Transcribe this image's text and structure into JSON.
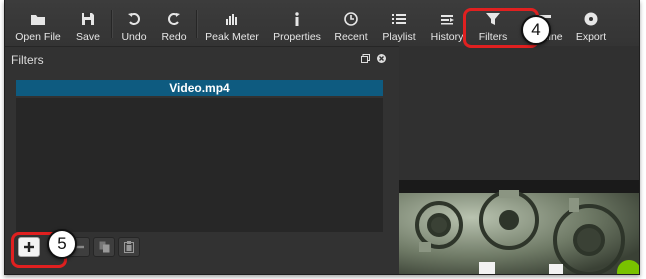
{
  "toolbar": {
    "items": [
      {
        "label": "Open File",
        "icon": "folder-icon"
      },
      {
        "label": "Save",
        "icon": "save-icon"
      },
      {
        "label": "Undo",
        "icon": "undo-icon"
      },
      {
        "label": "Redo",
        "icon": "redo-icon"
      },
      {
        "label": "Peak Meter",
        "icon": "peak-meter-icon"
      },
      {
        "label": "Properties",
        "icon": "info-icon"
      },
      {
        "label": "Recent",
        "icon": "clock-icon"
      },
      {
        "label": "Playlist",
        "icon": "list-icon"
      },
      {
        "label": "History",
        "icon": "history-icon"
      },
      {
        "label": "Filters",
        "icon": "funnel-icon"
      },
      {
        "label": "Timeline",
        "icon": "timeline-icon"
      },
      {
        "label": "Export",
        "icon": "disc-icon"
      }
    ]
  },
  "filters_panel": {
    "title": "Filters",
    "clip_name": "Video.mp4",
    "buttons": [
      {
        "name": "add-filter",
        "icon": "plus-icon"
      },
      {
        "name": "copy-filter",
        "icon": "copy-icon"
      },
      {
        "name": "paste-filter",
        "icon": "clipboard-icon"
      }
    ]
  },
  "callouts": {
    "step_filters": "4",
    "step_add": "5"
  },
  "colors": {
    "callout": "#e02020",
    "clip_bar": "#0e5b80",
    "background": "#323232"
  }
}
